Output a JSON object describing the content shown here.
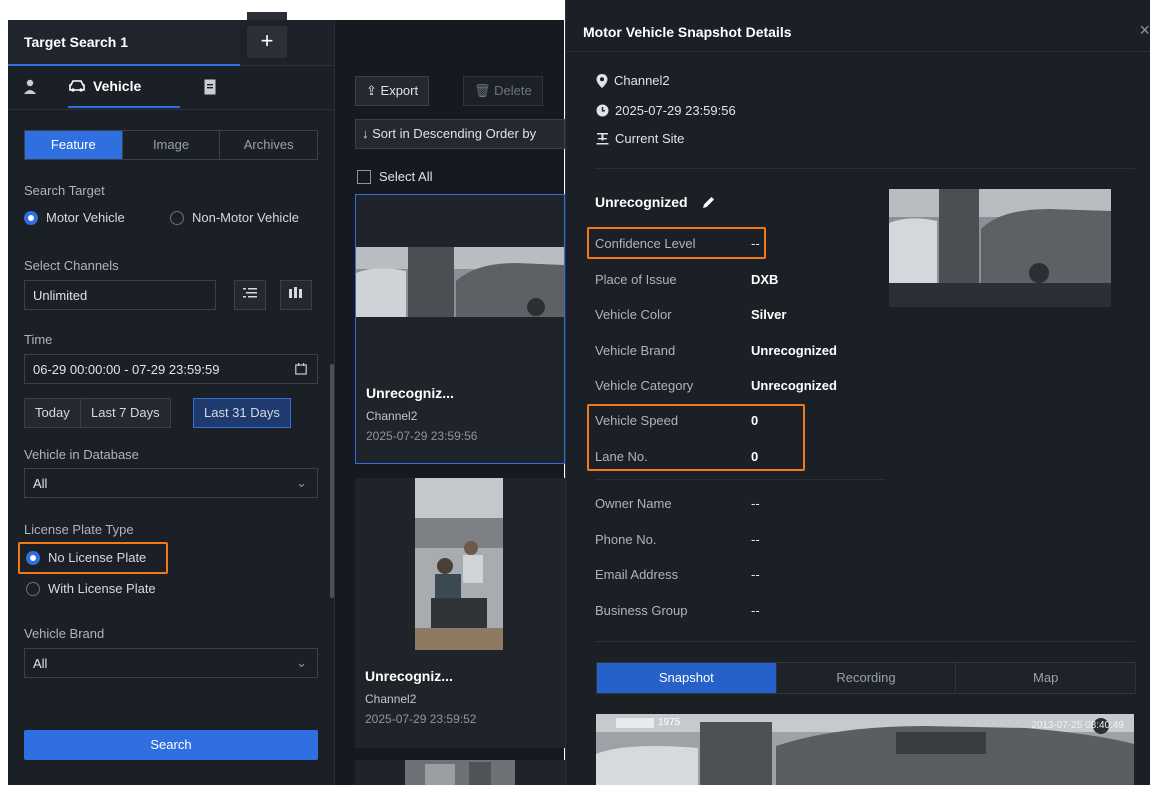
{
  "tab": {
    "title": "Target Search 1",
    "plus": "+"
  },
  "modes": {
    "vehicle": "Vehicle"
  },
  "segment": [
    "Feature",
    "Image",
    "Archives"
  ],
  "search_target": {
    "label": "Search Target",
    "options": [
      "Motor Vehicle",
      "Non-Motor Vehicle"
    ]
  },
  "channels": {
    "label": "Select Channels",
    "value": "Unlimited"
  },
  "time": {
    "label": "Time",
    "value": "06-29 00:00:00 - 07-29 23:59:59",
    "quick": [
      "Today",
      "Last 7 Days",
      "Last 31 Days"
    ]
  },
  "vehicle_db": {
    "label": "Vehicle in Database",
    "value": "All"
  },
  "plate_type": {
    "label": "License Plate Type",
    "options": [
      "No License Plate",
      "With License Plate"
    ]
  },
  "brand": {
    "label": "Vehicle Brand",
    "value": "All"
  },
  "search_button": "Search",
  "toolbar": {
    "export": "Export",
    "delete": "Delete",
    "sort": "Sort in Descending Order by",
    "select_all": "Select All"
  },
  "results": [
    {
      "title": "Unrecogniz...",
      "channel": "Channel2",
      "time": "2025-07-29 23:59:56"
    },
    {
      "title": "Unrecogniz...",
      "channel": "Channel2",
      "time": "2025-07-29 23:59:52"
    }
  ],
  "details": {
    "title": "Motor Vehicle Snapshot Details",
    "close": "×",
    "channel": "Channel2",
    "time": "2025-07-29 23:59:56",
    "site": "Current Site",
    "name": "Unrecognized",
    "fields": [
      {
        "k": "Confidence Level",
        "v": "--"
      },
      {
        "k": "Place of Issue",
        "v": "DXB"
      },
      {
        "k": "Vehicle Color",
        "v": "Silver"
      },
      {
        "k": "Vehicle Brand",
        "v": "Unrecognized"
      },
      {
        "k": "Vehicle Category",
        "v": "Unrecognized"
      },
      {
        "k": "Vehicle Speed",
        "v": "0"
      },
      {
        "k": "Lane No.",
        "v": "0"
      }
    ],
    "owner": [
      {
        "k": "Owner Name",
        "v": "--"
      },
      {
        "k": "Phone No.",
        "v": "--"
      },
      {
        "k": "Email Address",
        "v": "--"
      },
      {
        "k": "Business Group",
        "v": "--"
      }
    ],
    "tabs": [
      "Snapshot",
      "Recording",
      "Map"
    ],
    "plate_text": "1975",
    "snap_timestamp": "2013-07-25 08:40:49"
  },
  "colors": {
    "accent": "#2f6fe0",
    "highlight": "#ef7a1a"
  }
}
